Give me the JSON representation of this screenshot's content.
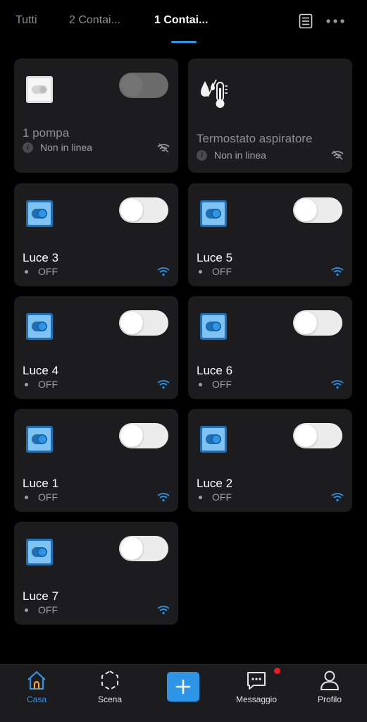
{
  "tabs": [
    {
      "label": "Tutti",
      "active": false
    },
    {
      "label": "2 Contai...",
      "active": false
    },
    {
      "label": "1 Contai...",
      "active": true
    }
  ],
  "top_icons": [
    "list-icon",
    "more-icon"
  ],
  "devices": [
    {
      "name": "1 pompa",
      "status": "Non in linea",
      "online": false,
      "icon": "switch-panel-icon",
      "toggle_enabled": false
    },
    {
      "name": "Termostato aspiratore",
      "status": "Non in linea",
      "online": false,
      "icon": "humidity-thermometer-icon",
      "toggle_enabled": false
    },
    {
      "name": "Luce 3",
      "status": "OFF",
      "online": true,
      "icon": "light-switch-icon",
      "toggle_enabled": true
    },
    {
      "name": "Luce 5",
      "status": "OFF",
      "online": true,
      "icon": "light-switch-icon",
      "toggle_enabled": true
    },
    {
      "name": "Luce 4",
      "status": "OFF",
      "online": true,
      "icon": "light-switch-icon",
      "toggle_enabled": true
    },
    {
      "name": "Luce 6",
      "status": "OFF",
      "online": true,
      "icon": "light-switch-icon",
      "toggle_enabled": true
    },
    {
      "name": "Luce 1",
      "status": "OFF",
      "online": true,
      "icon": "light-switch-icon",
      "toggle_enabled": true
    },
    {
      "name": "Luce 2",
      "status": "OFF",
      "online": true,
      "icon": "light-switch-icon",
      "toggle_enabled": true
    },
    {
      "name": "Luce 7",
      "status": "OFF",
      "online": true,
      "icon": "light-switch-icon",
      "toggle_enabled": true
    }
  ],
  "bottom_nav": [
    {
      "label": "Casa",
      "icon": "home-icon",
      "active": true
    },
    {
      "label": "Scena",
      "icon": "scene-icon",
      "active": false
    },
    {
      "label": "",
      "icon": "plus-icon",
      "active": false
    },
    {
      "label": "Messaggio",
      "icon": "message-icon",
      "active": false,
      "has_badge": true
    },
    {
      "label": "Profilo",
      "icon": "profile-icon",
      "active": false
    }
  ],
  "colors": {
    "accent": "#2e95e6",
    "background": "#000000",
    "card": "#1c1c1e",
    "badge": "#ea1c22"
  }
}
